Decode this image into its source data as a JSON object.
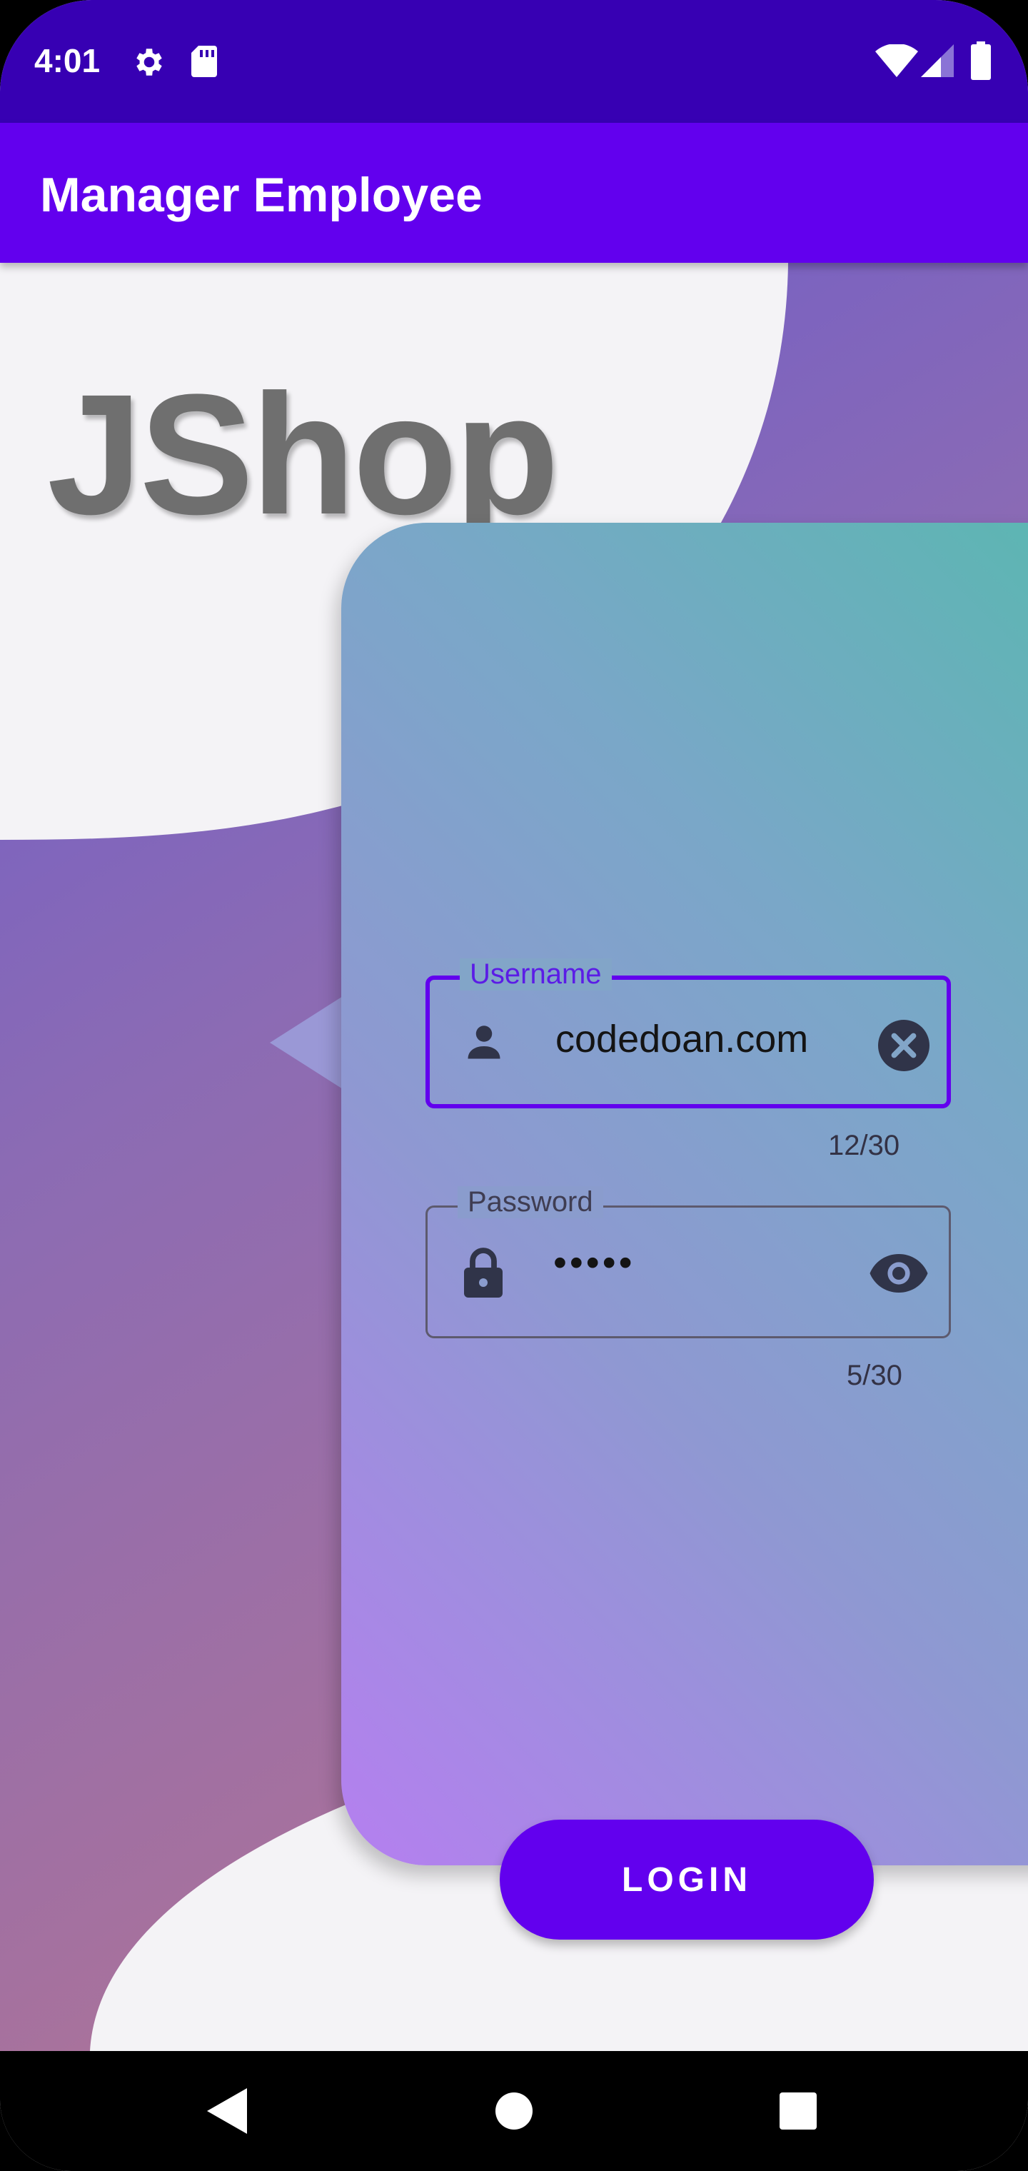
{
  "status_bar": {
    "time": "4:01",
    "icons": [
      "settings-icon",
      "sd-card-icon",
      "wifi-icon",
      "signal-icon",
      "battery-icon"
    ]
  },
  "app_bar": {
    "title": "Manager Employee"
  },
  "brand": {
    "text": "JShop"
  },
  "form": {
    "username": {
      "label": "Username",
      "value": "codedoan.com",
      "counter": "12/30",
      "leading_icon": "person-icon",
      "trailing_icon": "clear-icon"
    },
    "password": {
      "label": "Password",
      "value": "•••••",
      "counter": "5/30",
      "leading_icon": "lock-icon",
      "trailing_icon": "eye-icon"
    },
    "login_label": "LOGIN"
  },
  "nav_bar": {
    "icons": [
      "back-icon",
      "home-icon",
      "recents-icon"
    ]
  },
  "colors": {
    "status_bar": "#3700b3",
    "app_bar": "#6200ee",
    "accent": "#6200ee",
    "brand_text": "#6f6f6f"
  }
}
